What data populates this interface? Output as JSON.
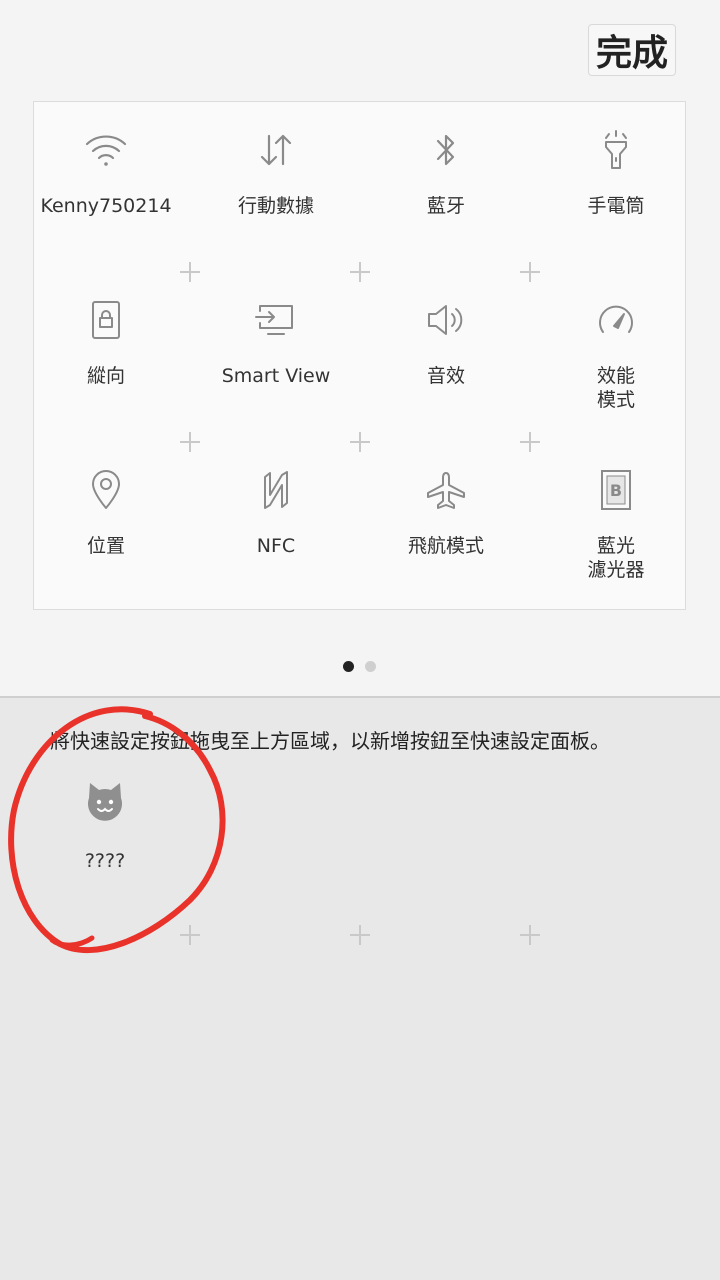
{
  "header": {
    "done_label": "完成"
  },
  "active_tiles": [
    {
      "label": "Kenny750214",
      "icon": "wifi-icon"
    },
    {
      "label": "行動數據",
      "icon": "mobile-data-icon"
    },
    {
      "label": "藍牙",
      "icon": "bluetooth-icon"
    },
    {
      "label": "手電筒",
      "icon": "flashlight-icon"
    },
    {
      "label": "縱向",
      "icon": "portrait-lock-icon"
    },
    {
      "label": "Smart View",
      "icon": "smart-view-icon"
    },
    {
      "label": "音效",
      "icon": "sound-icon"
    },
    {
      "label": "效能\n模式",
      "icon": "performance-mode-icon"
    },
    {
      "label": "位置",
      "icon": "location-icon"
    },
    {
      "label": "NFC",
      "icon": "nfc-icon"
    },
    {
      "label": "飛航模式",
      "icon": "airplane-icon"
    },
    {
      "label": "藍光\n濾光器",
      "icon": "blue-light-filter-icon"
    }
  ],
  "pagination": {
    "pages": 2,
    "current": 1
  },
  "available": {
    "instruction": "將快速設定按鈕拖曳至上方區域，以新增按鈕至快速設定面板。",
    "tiles": [
      {
        "label": "????",
        "icon": "cat-icon"
      }
    ]
  },
  "colors": {
    "icon_gray": "#8a8a8a",
    "annotation_red": "#e8322a"
  }
}
